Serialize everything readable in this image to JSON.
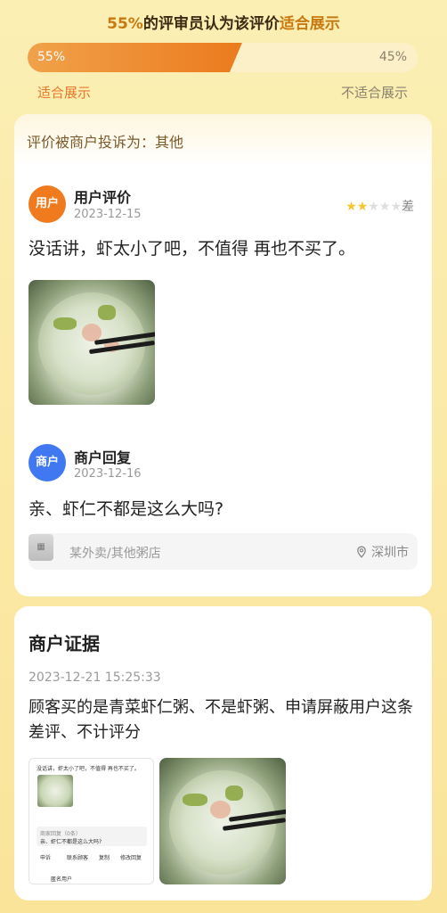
{
  "header": {
    "title_pct": "55%",
    "title_mid": "的评审员认为该评价",
    "title_end": "适合展示",
    "agree_pct": "55%",
    "disagree_pct": "45%",
    "agree_fraction": 0.55,
    "agree_label": "适合展示",
    "disagree_label": "不适合展示"
  },
  "review": {
    "complaint": "评价被商户投诉为：其他",
    "user_avatar": "用户",
    "user_label": "用户评价",
    "user_date": "2023-12-15",
    "rating": 2,
    "rating_max": 5,
    "rating_text": "差",
    "text": "没话讲，虾太小了吧，不值得 再也不买了。",
    "reply_avatar": "商户",
    "reply_label": "商户回复",
    "reply_date": "2023-12-16",
    "reply_text": "亲、虾仁不都是这么大吗?",
    "shop_name": "某外卖/其他粥店",
    "shop_location": "深圳市",
    "pin_icon": "location-pin-icon"
  },
  "evidence": {
    "title": "商户证据",
    "time": "2023-12-21 15:25:33",
    "text": "顾客买的是青菜虾仁粥、不是虾粥、申请屏蔽用户这条差评、不计评分",
    "shot_review": "没话讲，虾太小了吧，不值得 再也不买了。",
    "shot_reply_label": "商家回复（0条）",
    "shot_reply_text": "亲、虾仁不都是这么大吗?",
    "shot_actions": [
      "申诉",
      "联系顾客",
      "复制",
      "修改回复"
    ],
    "shot_user": "匿名用户"
  },
  "colors": {
    "accent_orange": "#ef7b1e",
    "accent_blue": "#3f78f0",
    "star": "#f6c530"
  }
}
